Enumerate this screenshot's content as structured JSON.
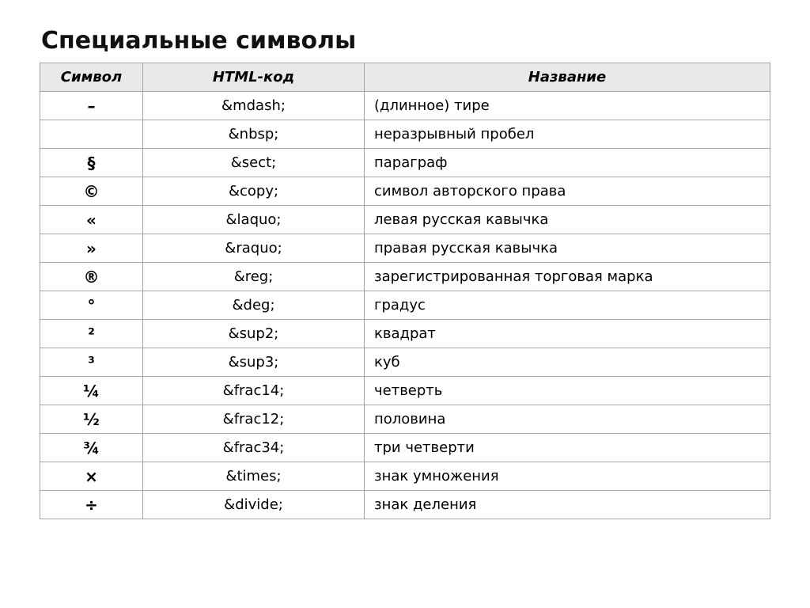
{
  "title": "Специальные символы",
  "headers": {
    "symbol": "Символ",
    "code": "HTML-код",
    "name": "Название"
  },
  "rows": [
    {
      "symbol": "–",
      "code": "&mdash;",
      "name": "(длинное) тире"
    },
    {
      "symbol": "",
      "code": "&nbsp;",
      "name": "неразрывный пробел"
    },
    {
      "symbol": "§",
      "code": "&sect;",
      "name": "параграф"
    },
    {
      "symbol": "©",
      "code": "&copy;",
      "name": "символ авторского права"
    },
    {
      "symbol": "«",
      "code": "&laquo;",
      "name": "левая русская кавычка"
    },
    {
      "symbol": "»",
      "code": "&raquo;",
      "name": "правая русская кавычка"
    },
    {
      "symbol": "®",
      "code": "&reg;",
      "name": "зарегистрированная торговая марка"
    },
    {
      "symbol": "°",
      "code": "&deg;",
      "name": "градус"
    },
    {
      "symbol": "²",
      "code": "&sup2;",
      "name": "квадрат"
    },
    {
      "symbol": "³",
      "code": "&sup3;",
      "name": "куб"
    },
    {
      "symbol": "¼",
      "code": "&frac14;",
      "name": "четверть"
    },
    {
      "symbol": "½",
      "code": "&frac12;",
      "name": "половина"
    },
    {
      "symbol": "¾",
      "code": "&frac34;",
      "name": "три четверти"
    },
    {
      "symbol": "×",
      "code": "&times;",
      "name": "знак умножения"
    },
    {
      "symbol": "÷",
      "code": "&divide;",
      "name": "знак деления"
    }
  ]
}
